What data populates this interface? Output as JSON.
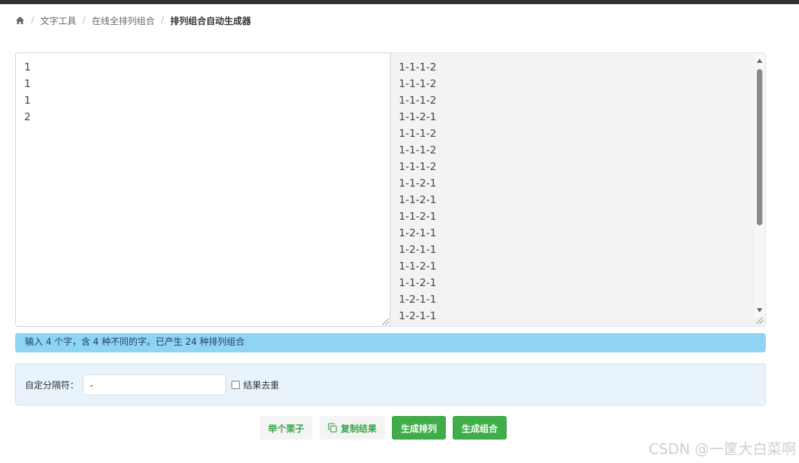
{
  "breadcrumb": {
    "items": [
      "文字工具",
      "在线全排列组合"
    ],
    "current": "排列组合自动生成器"
  },
  "input": {
    "lines": [
      "1",
      "1",
      "1",
      "2"
    ]
  },
  "result": {
    "lines": [
      "1-1-1-2",
      "1-1-1-2",
      "1-1-1-2",
      "1-1-2-1",
      "1-1-1-2",
      "1-1-1-2",
      "1-1-1-2",
      "1-1-2-1",
      "1-1-2-1",
      "1-1-2-1",
      "1-2-1-1",
      "1-2-1-1",
      "1-1-2-1",
      "1-1-2-1",
      "1-2-1-1",
      "1-2-1-1"
    ]
  },
  "status": {
    "text": "输入 4 个字，含 4 种不同的字。已产生 24 种排列组合"
  },
  "options": {
    "separator_label": "自定分隔符：",
    "separator_value": "-",
    "dedupe_label": "结果去重"
  },
  "buttons": {
    "example": "举个栗子",
    "copy": "复制结果",
    "permute": "生成排列",
    "combine": "生成组合"
  },
  "watermark": "CSDN @一筐大白菜啊",
  "colors": {
    "status_bg": "#8fd3f5",
    "options_bg": "#e8f3fc",
    "primary_green": "#3fae49",
    "topbar": "#2f3338"
  }
}
